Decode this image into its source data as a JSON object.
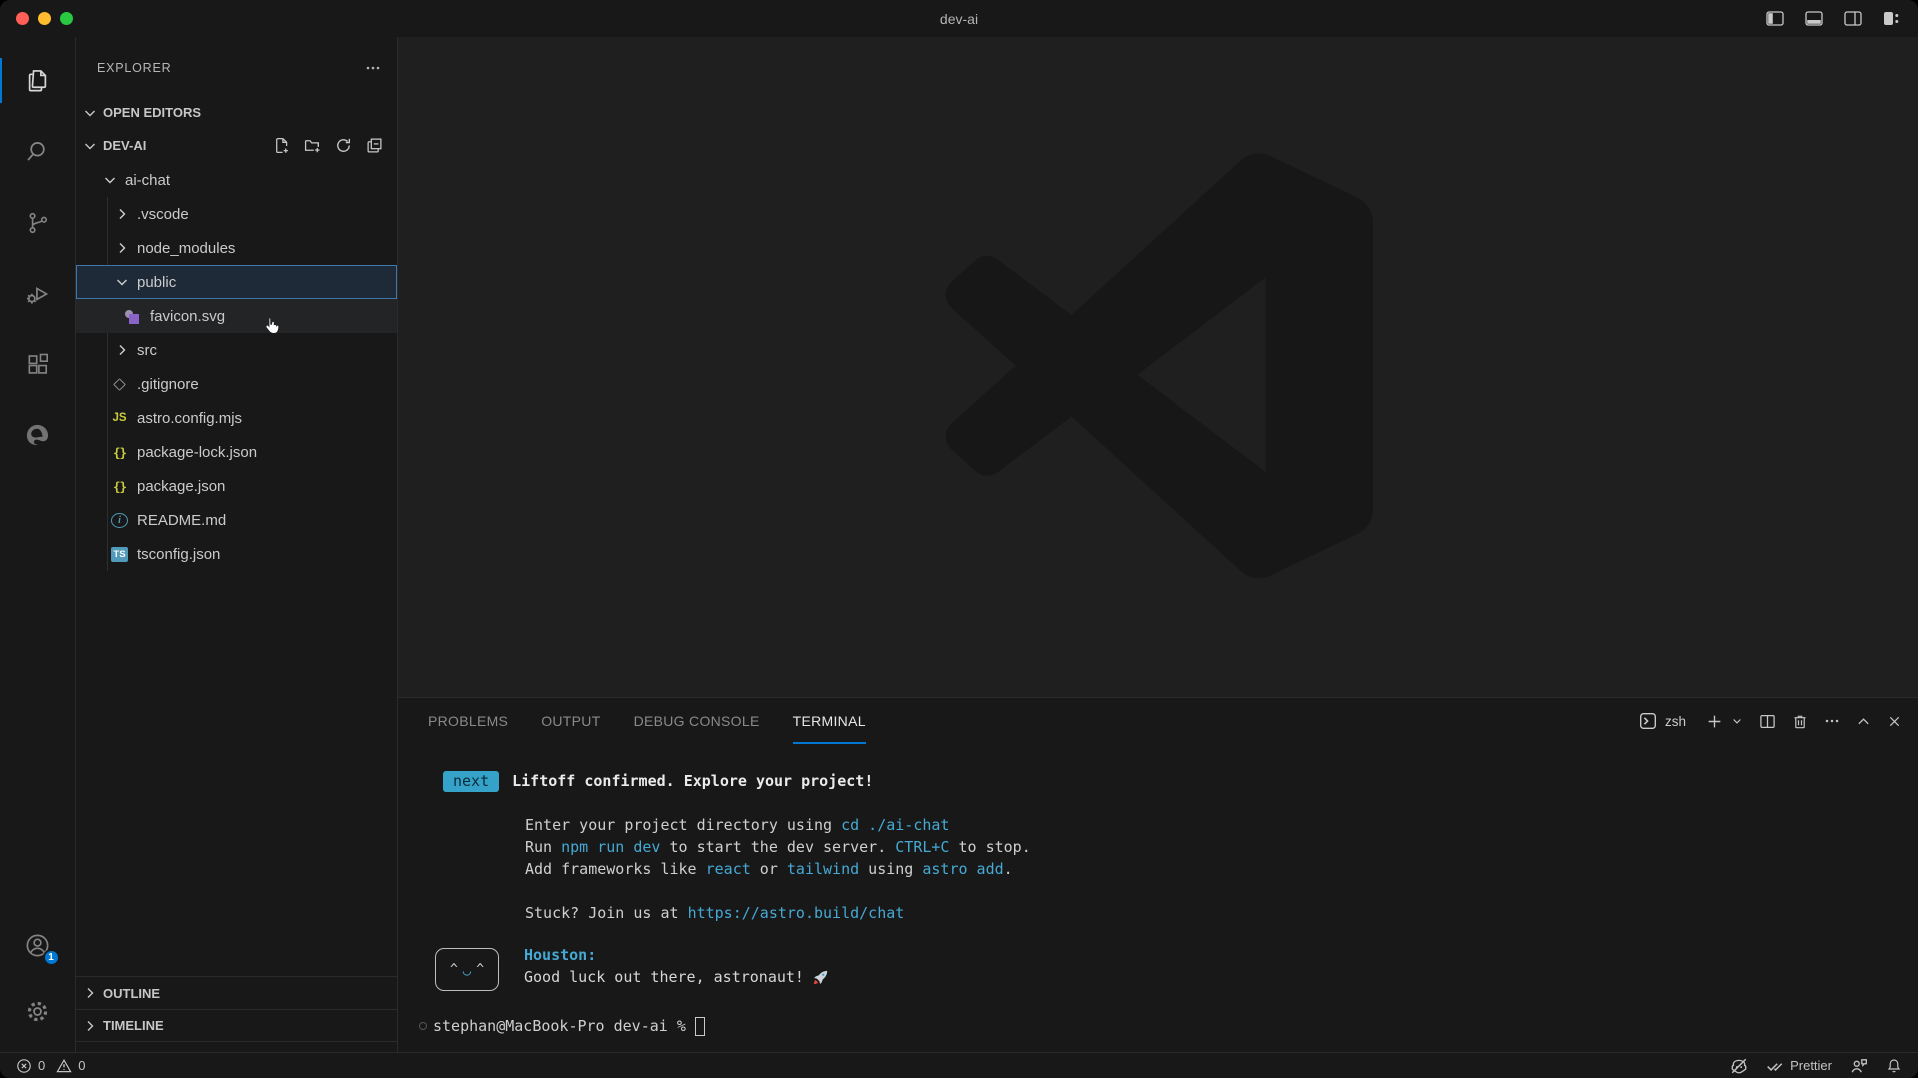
{
  "window": {
    "title": "dev-ai"
  },
  "colors": {
    "chrome_bg": "#181818",
    "editor_bg": "#1f1f1f",
    "border": "#2b2b2b",
    "accent": "#0078d4",
    "terminal_cyan": "#45a9d4",
    "badge_bg": "#35a3c9",
    "badge_fg": "#0b2b38",
    "sel_border": "#3f77ac",
    "svg_purple": "#8a63c9",
    "js_yellow": "#cbcb41",
    "ts_blue": "#519aba",
    "traffic_red": "#ff5f57",
    "traffic_yellow": "#febc2e",
    "traffic_green": "#28c840"
  },
  "activity_bar": {
    "items": [
      "explorer",
      "search",
      "source-control",
      "run-and-debug",
      "extensions",
      "edge-tools"
    ],
    "active_item": "explorer",
    "account_badge": "1"
  },
  "explorer": {
    "title": "EXPLORER",
    "sections": {
      "open_editors": "OPEN EDITORS",
      "project": "DEV-AI",
      "outline": "OUTLINE",
      "timeline": "TIMELINE"
    },
    "tree": [
      {
        "label": "ai-chat",
        "kind": "folder",
        "expanded": true,
        "level": 0
      },
      {
        "label": ".vscode",
        "kind": "folder",
        "expanded": false,
        "level": 1
      },
      {
        "label": "node_modules",
        "kind": "folder",
        "expanded": false,
        "level": 1
      },
      {
        "label": "public",
        "kind": "folder",
        "expanded": true,
        "level": 1,
        "selected": true
      },
      {
        "label": "favicon.svg",
        "kind": "file",
        "icon": "svg",
        "level": 2,
        "hovered": true
      },
      {
        "label": "src",
        "kind": "folder",
        "expanded": false,
        "level": 1
      },
      {
        "label": ".gitignore",
        "kind": "file",
        "icon": "git",
        "level": 1
      },
      {
        "label": "astro.config.mjs",
        "kind": "file",
        "icon": "js",
        "icon_text": "JS",
        "level": 1
      },
      {
        "label": "package-lock.json",
        "kind": "file",
        "icon": "braces",
        "icon_text": "{}",
        "level": 1
      },
      {
        "label": "package.json",
        "kind": "file",
        "icon": "braces",
        "icon_text": "{}",
        "level": 1
      },
      {
        "label": "README.md",
        "kind": "file",
        "icon": "info",
        "icon_text": "i",
        "level": 1
      },
      {
        "label": "tsconfig.json",
        "kind": "file",
        "icon": "ts",
        "icon_text": "TS",
        "level": 1
      }
    ]
  },
  "panel": {
    "tabs": [
      "PROBLEMS",
      "OUTPUT",
      "DEBUG CONSOLE",
      "TERMINAL"
    ],
    "active_tab": "TERMINAL",
    "shell": "zsh"
  },
  "terminal": {
    "banner": {
      "badge": "next",
      "title": "Liftoff confirmed. Explore your project!"
    },
    "lines": [
      {
        "blank": true
      },
      {
        "indent": true,
        "segments": [
          {
            "text": "Enter your project directory using ",
            "style": "fg"
          },
          {
            "text": "cd ./ai-chat",
            "style": "cyan"
          }
        ]
      },
      {
        "indent": true,
        "segments": [
          {
            "text": "Run ",
            "style": "fg"
          },
          {
            "text": "npm run dev",
            "style": "cyan"
          },
          {
            "text": " to start the dev server. ",
            "style": "fg"
          },
          {
            "text": "CTRL+C",
            "style": "cyan"
          },
          {
            "text": " to stop.",
            "style": "fg"
          }
        ]
      },
      {
        "indent": true,
        "segments": [
          {
            "text": "Add frameworks like ",
            "style": "fg"
          },
          {
            "text": "react",
            "style": "cyan"
          },
          {
            "text": " or ",
            "style": "fg"
          },
          {
            "text": "tailwind",
            "style": "cyan"
          },
          {
            "text": " using ",
            "style": "fg"
          },
          {
            "text": "astro add",
            "style": "cyan"
          },
          {
            "text": ".",
            "style": "fg"
          }
        ]
      },
      {
        "blank": true
      },
      {
        "indent": true,
        "segments": [
          {
            "text": "Stuck? Join us at ",
            "style": "fg"
          },
          {
            "text": "https://astro.build/chat",
            "style": "cyan",
            "link": true
          }
        ]
      }
    ],
    "houston": {
      "name": "Houston:",
      "message": "Good luck out there, astronaut!",
      "eye": "^",
      "mouth": "◡"
    },
    "prompt": "stephan@MacBook-Pro dev-ai %"
  },
  "status_bar": {
    "errors": "0",
    "warnings": "0",
    "prettier_label": "Prettier"
  }
}
